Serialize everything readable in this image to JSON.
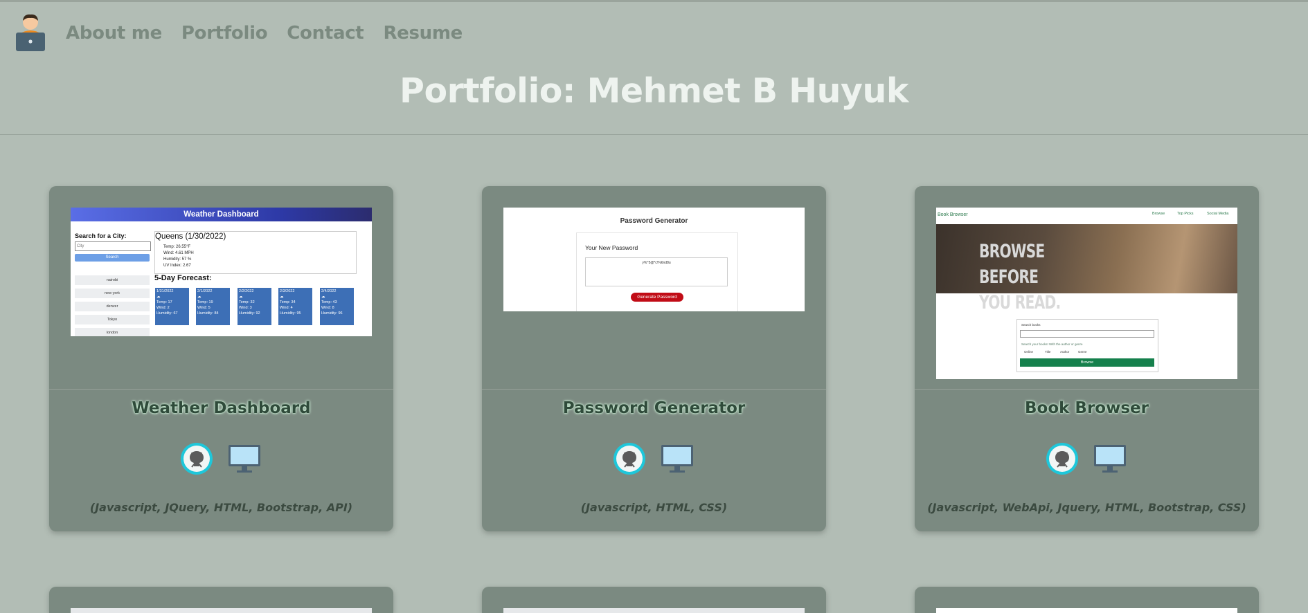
{
  "nav": {
    "items": [
      {
        "label": "About me"
      },
      {
        "label": "Portfolio"
      },
      {
        "label": "Contact"
      },
      {
        "label": "Resume"
      }
    ]
  },
  "page": {
    "title": "Portfolio: Mehmet B Huyuk"
  },
  "projects": [
    {
      "name": "Weather Dashboard",
      "tech": "(Javascript, JQuery, HTML, Bootstrap, API)",
      "thumb": {
        "header": "Weather Dashboard",
        "search_label": "Search for a City:",
        "search_placeholder": "City",
        "search_button": "Search",
        "cities": [
          "nairobi",
          "new york",
          "denver",
          "Tokyo",
          "london"
        ],
        "current_title": "Queens (1/30/2022)",
        "current_lines": [
          "Temp: 26.55°F",
          "Wind: 4.61 MPH",
          "Humidity: 57 %",
          "UV Index: 2.67"
        ],
        "forecast_label": "5-Day Forecast:",
        "forecast": [
          {
            "date": "1/31/2022",
            "temp": "Temp: 17",
            "wind": "Wind: 2",
            "humidity": "Humidity: 67"
          },
          {
            "date": "2/1/2022",
            "temp": "Temp: 19",
            "wind": "Wind: 5",
            "humidity": "Humidity: 84"
          },
          {
            "date": "2/2/2022",
            "temp": "Temp: 32",
            "wind": "Wind: 3",
            "humidity": "Humidity: 92"
          },
          {
            "date": "2/3/2022",
            "temp": "Temp: 34",
            "wind": "Wind: 4",
            "humidity": "Humidity: 95"
          },
          {
            "date": "2/4/2022",
            "temp": "Temp: 43",
            "wind": "Wind: 8",
            "humidity": "Humidity: 96"
          }
        ]
      }
    },
    {
      "name": "Password Generator",
      "tech": "(Javascript, HTML, CSS)",
      "thumb": {
        "header": "Password Generator",
        "subheader": "Your New Password",
        "password": "y%^5@*c!%6nd8u",
        "button": "Generate Password"
      }
    },
    {
      "name": "Book Browser",
      "tech": "(Javascript, WebApi, Jquery, HTML, Bootstrap, CSS)",
      "thumb": {
        "brand": "Book Browser",
        "nav": [
          "Browse",
          "Top Picks",
          "Social Media"
        ],
        "hero": "BROWSE BEFORE YOU READ.",
        "form_label": "Search books",
        "form_hint": "Search your books! With the author or genre",
        "options": [
          "Online",
          "Title",
          "Author",
          "Genre"
        ],
        "button": "Browse"
      }
    }
  ],
  "colors": {
    "background": "#b2bdb5",
    "card": "#7b8a81",
    "nav_text": "#7b8a80",
    "title_text": "#eef3ef",
    "github_ring": "#1ec7da"
  }
}
